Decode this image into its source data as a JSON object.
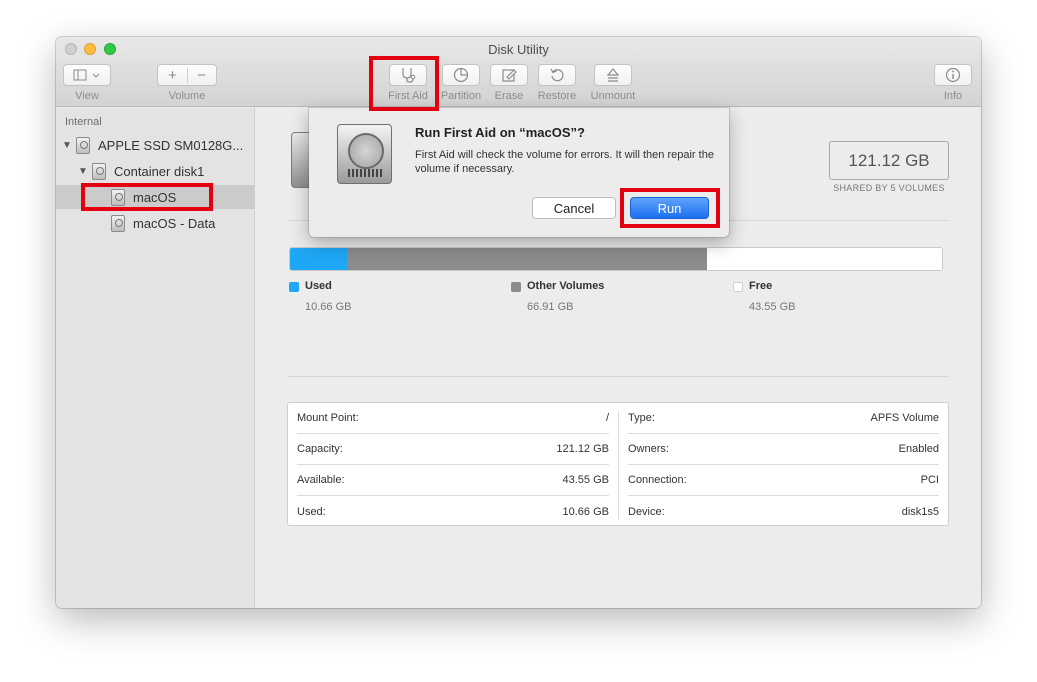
{
  "window": {
    "title": "Disk Utility"
  },
  "toolbar": {
    "view_label": "View",
    "volume_label": "Volume",
    "volume_add": "+",
    "volume_remove": "−",
    "first_aid_label": "First Aid",
    "partition_label": "Partition",
    "erase_label": "Erase",
    "restore_label": "Restore",
    "unmount_label": "Unmount",
    "info_label": "Info"
  },
  "sidebar": {
    "header": "Internal",
    "items": [
      {
        "label": "APPLE SSD SM0128G..."
      },
      {
        "label": "Container disk1"
      },
      {
        "label": "macOS"
      },
      {
        "label": "macOS - Data"
      }
    ]
  },
  "main": {
    "capacity": "121.12 GB",
    "capacity_sub": "SHARED BY 5 VOLUMES",
    "usage": [
      {
        "name": "Used",
        "value": "10.66 GB",
        "color": "#1ea7f5",
        "fraction": 0.088
      },
      {
        "name": "Other Volumes",
        "value": "66.91 GB",
        "color": "#8c8c8c",
        "fraction": 0.552
      },
      {
        "name": "Free",
        "value": "43.55 GB",
        "color": "#ffffff",
        "fraction": 0.36
      }
    ],
    "info_left": [
      {
        "label": "Mount Point:",
        "value": "/"
      },
      {
        "label": "Capacity:",
        "value": "121.12 GB"
      },
      {
        "label": "Available:",
        "value": "43.55 GB"
      },
      {
        "label": "Used:",
        "value": "10.66 GB"
      }
    ],
    "info_right": [
      {
        "label": "Type:",
        "value": "APFS Volume"
      },
      {
        "label": "Owners:",
        "value": "Enabled"
      },
      {
        "label": "Connection:",
        "value": "PCI"
      },
      {
        "label": "Device:",
        "value": "disk1s5"
      }
    ]
  },
  "dialog": {
    "title": "Run First Aid on “macOS”?",
    "message": "First Aid will check the volume for errors. It will then repair the volume if necessary.",
    "cancel_label": "Cancel",
    "run_label": "Run"
  },
  "highlight_color": "#e3000f"
}
